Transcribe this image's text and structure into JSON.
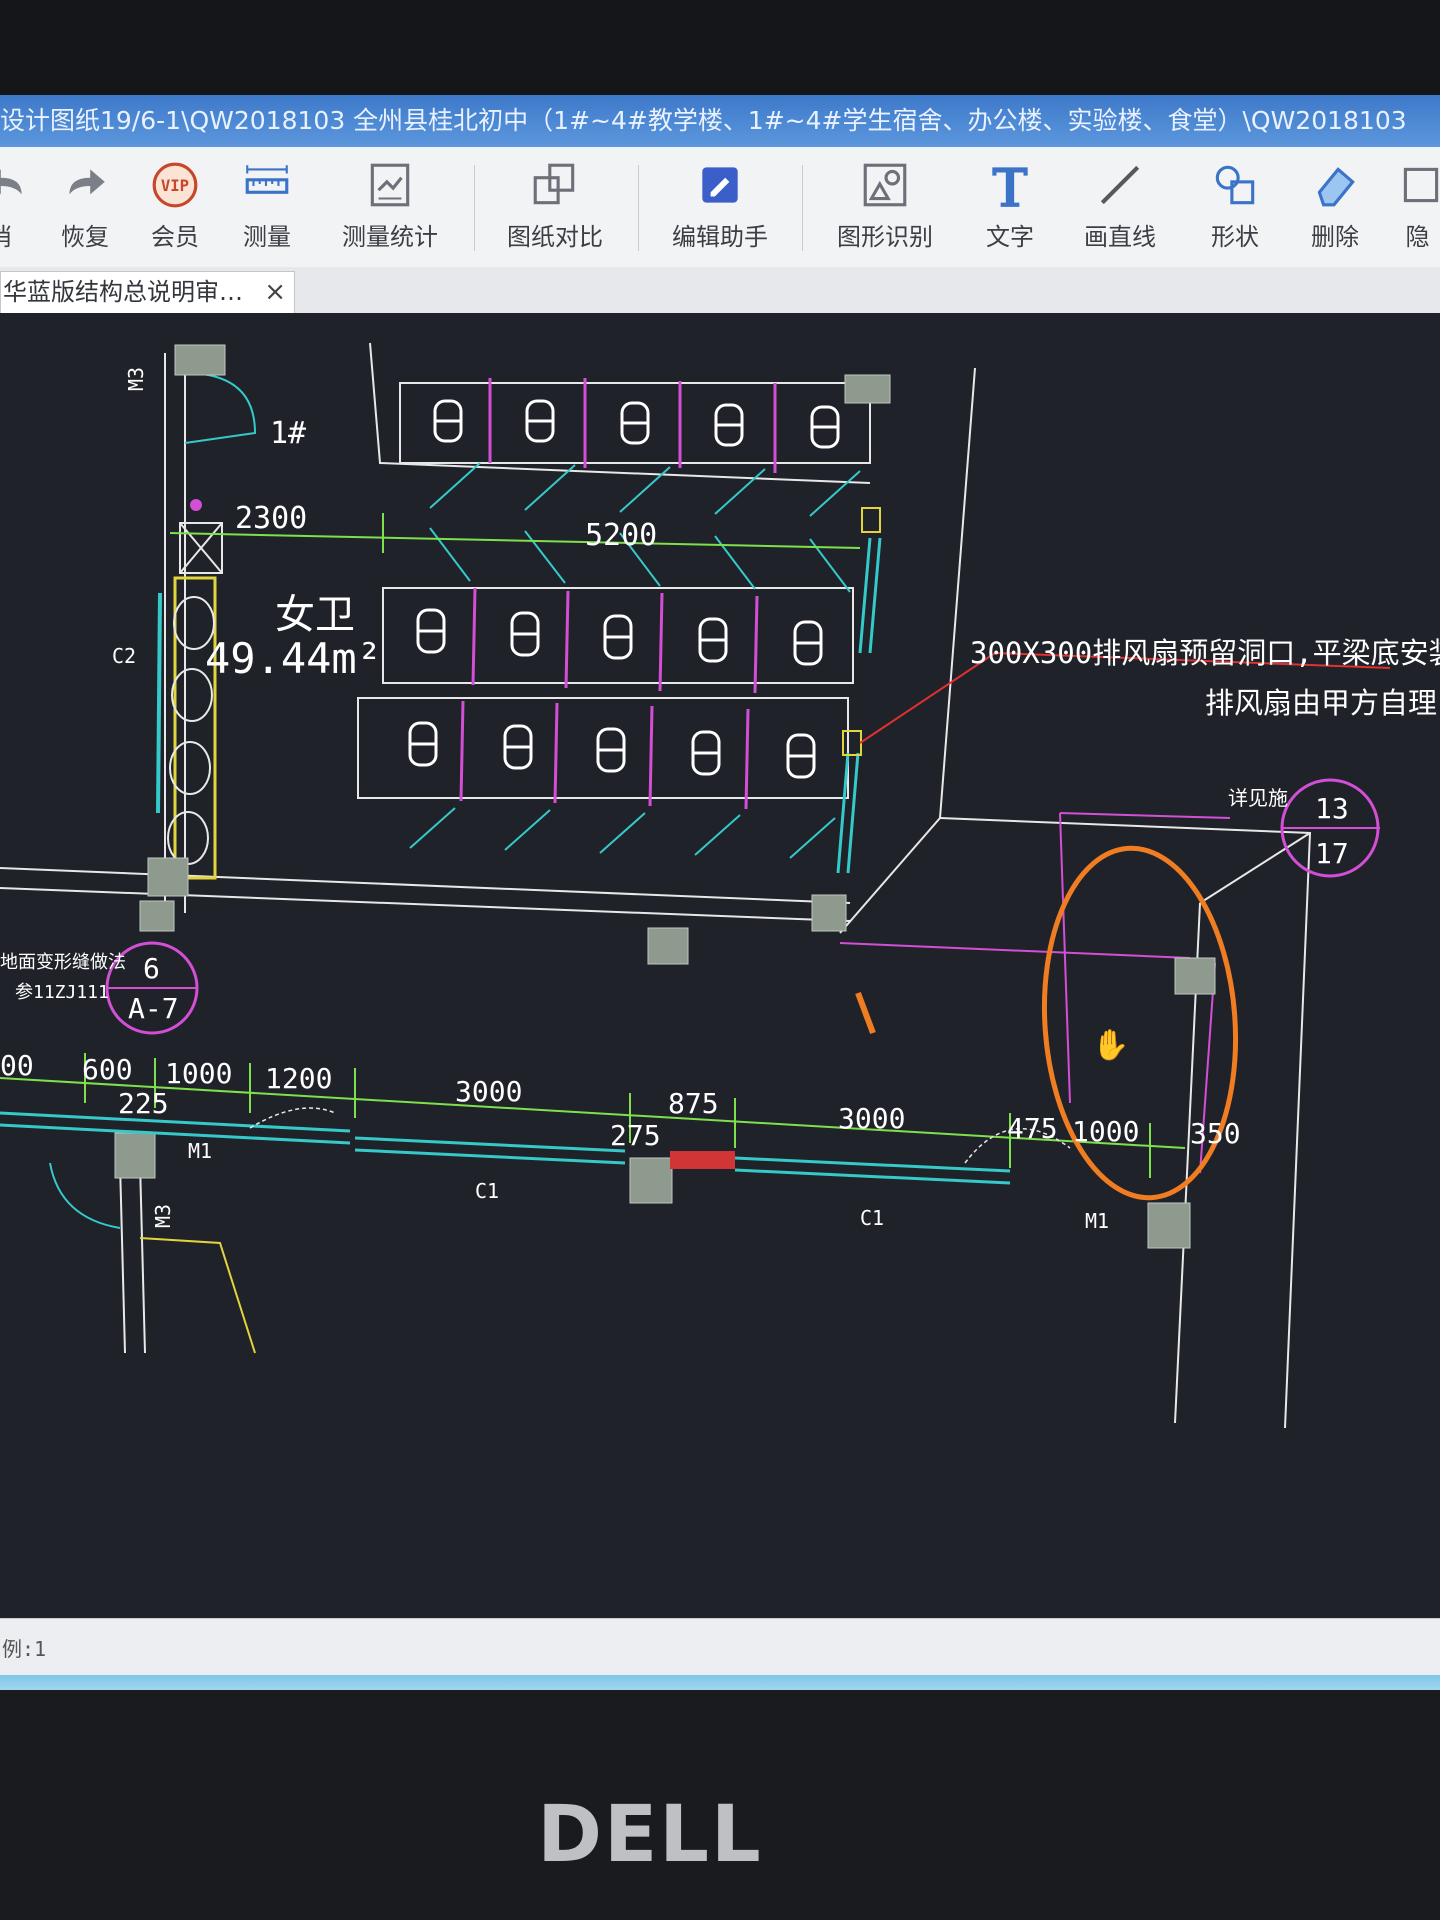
{
  "window": {
    "title": "设计图纸19/6-1\\QW2018103 全州县桂北初中（1#~4#教学楼、1#~4#学生宿舍、办公楼、实验楼、食堂）\\QW2018103"
  },
  "toolbar": {
    "items": [
      {
        "label": "消",
        "icon": "undo-icon"
      },
      {
        "label": "恢复",
        "icon": "redo-icon"
      },
      {
        "label": "会员",
        "icon": "vip-icon"
      },
      {
        "label": "测量",
        "icon": "ruler-icon"
      },
      {
        "label": "测量统计",
        "icon": "measure-stats-icon"
      },
      {
        "label": "图纸对比",
        "icon": "compare-icon"
      },
      {
        "label": "编辑助手",
        "icon": "edit-assistant-icon"
      },
      {
        "label": "图形识别",
        "icon": "shape-recognition-icon"
      },
      {
        "label": "文字",
        "icon": "text-icon"
      },
      {
        "label": "画直线",
        "icon": "line-icon"
      },
      {
        "label": "形状",
        "icon": "shape-icon"
      },
      {
        "label": "删除",
        "icon": "eraser-icon"
      },
      {
        "label": "隐",
        "icon": "hide-icon"
      }
    ]
  },
  "tabs": [
    {
      "label": "华蓝版结构总说明审…",
      "close": "×"
    }
  ],
  "drawing": {
    "room_number": "1#",
    "room_name": "女卫",
    "room_area": "49.44m²",
    "door_m3": "M3",
    "dim_2300": "2300",
    "dim_5200": "5200",
    "note_line1": "300X300排风扇预留洞口,平梁底安装",
    "note_line2": "排风扇由甲方自理",
    "detail_label": "详见施",
    "detail_top": "13",
    "detail_bottom": "17",
    "ref_label1": "地面变形缝做法",
    "ref_label2": "参11ZJ111",
    "ref_top": "6",
    "ref_bottom": "A-7",
    "dims_bottom": [
      "00",
      "600",
      "1000",
      "1200",
      "3000",
      "875",
      "3000",
      "475",
      "1000",
      "350"
    ],
    "dim_225": "225",
    "dim_275": "275",
    "win_c1_a": "C1",
    "win_c1_b": "C1",
    "door_m1_a": "M1",
    "door_m1_b": "M1",
    "side_label_left": "C2",
    "side_label_m3b": "M3"
  },
  "status": {
    "scale": "例:1"
  },
  "brand": "DELL",
  "colors": {
    "canvas": "#20222a",
    "dimension": "#7ee04a",
    "wall": "#e8e8e8",
    "magenta": "#d24fd6",
    "cyan": "#35c9c9",
    "yellow": "#e2d43c",
    "annotation_circle": "#f07d22",
    "leader": "#e03030"
  }
}
